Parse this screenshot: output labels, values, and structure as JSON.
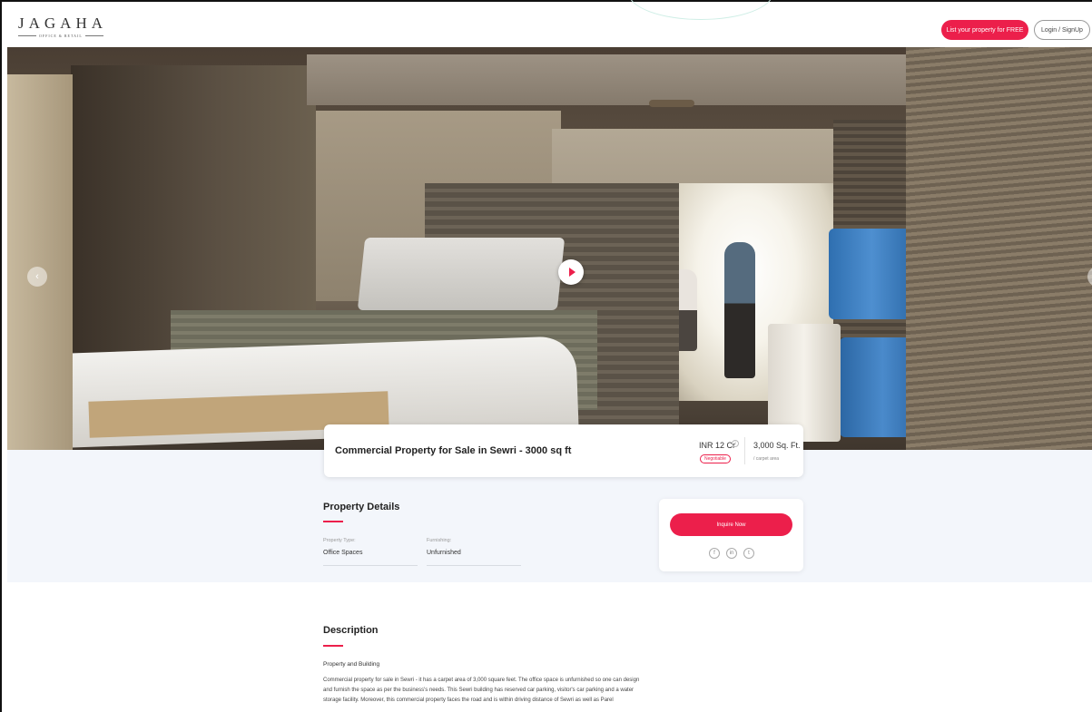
{
  "header": {
    "logo_text": "JAGAHA",
    "logo_tagline": "OFFICE & RETAIL",
    "list_property_label": "List your property for FREE",
    "login_label": "Login / SignUp"
  },
  "hero": {
    "prev_icon": "chevron-left-icon",
    "next_icon": "chevron-right-icon",
    "play_icon": "play-icon"
  },
  "listing": {
    "title": "Commercial Property for Sale in Sewri - 3000 sq ft",
    "price": "INR 12 Cr",
    "price_info_icon": "info-icon",
    "negotiable": "Negotiable",
    "area": "3,000 Sq. Ft.",
    "area_unit": "/ carpet area"
  },
  "details": {
    "heading": "Property Details",
    "items": [
      {
        "label": "Property Type:",
        "value": "Office Spaces"
      },
      {
        "label": "Furnishing:",
        "value": "Unfurnished"
      }
    ]
  },
  "inquiry": {
    "button_label": "Inquire Now",
    "social": [
      {
        "icon": "facebook-icon",
        "glyph": "f"
      },
      {
        "icon": "linkedin-icon",
        "glyph": "in"
      },
      {
        "icon": "twitter-icon",
        "glyph": "t"
      }
    ]
  },
  "description": {
    "heading": "Description",
    "subheading": "Property and Building",
    "body": "Commercial property for sale in Sewri - it has a carpet area of 3,000 square feet. The office space is unfurnished so one can design and furnish the space as per the business's needs. This Sewri building has reserved car parking, visitor's car parking and a water storage facility. Moreover, this commercial property faces the road and is within driving distance of Sewri as well as Parel"
  },
  "colors": {
    "accent": "#ec1f4b",
    "band": "#f3f6fb"
  }
}
